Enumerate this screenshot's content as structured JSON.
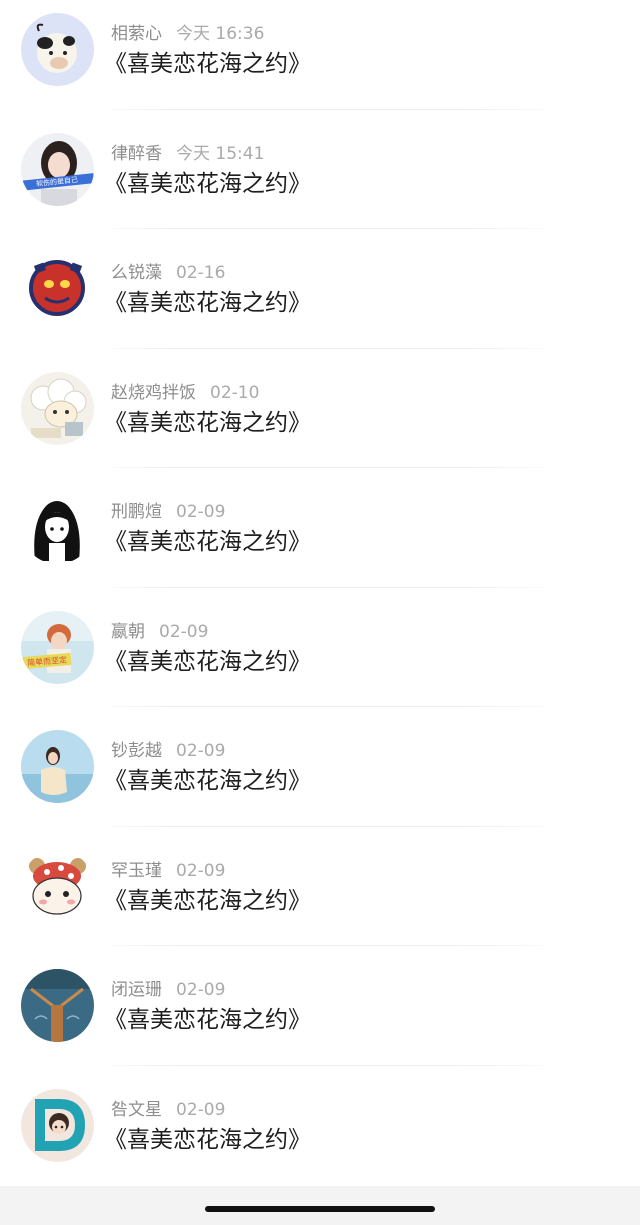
{
  "comments": [
    {
      "name": "相萦心",
      "time": "今天 16:36",
      "message": "《喜美恋花海之约》",
      "avatar_icon": "cartoon-cow-avatar",
      "accent": "#dbe4f7"
    },
    {
      "name": "律醉香",
      "time": "今天 15:41",
      "message": "《喜美恋花海之约》",
      "avatar_icon": "girl-portrait-avatar",
      "accent": "#3a6fd8"
    },
    {
      "name": "么锐藻",
      "time": "02-16",
      "message": "《喜美恋花海之约》",
      "avatar_icon": "red-creature-avatar",
      "accent": "#c8322a"
    },
    {
      "name": "赵烧鸡拌饭",
      "time": "02-10",
      "message": "《喜美恋花海之约》",
      "avatar_icon": "sheep-cartoon-avatar",
      "accent": "#f1ede4"
    },
    {
      "name": "刑鹏煊",
      "time": "02-09",
      "message": "《喜美恋花海之约》",
      "avatar_icon": "anime-girl-avatar",
      "accent": "#111111"
    },
    {
      "name": "嬴朝",
      "time": "02-09",
      "message": "《喜美恋花海之约》",
      "avatar_icon": "redhead-girl-avatar",
      "accent": "#d9a45a"
    },
    {
      "name": "钞彭越",
      "time": "02-09",
      "message": "《喜美恋花海之约》",
      "avatar_icon": "beach-girl-avatar",
      "accent": "#9ccbe6"
    },
    {
      "name": "罕玉瑾",
      "time": "02-09",
      "message": "《喜美恋花海之约》",
      "avatar_icon": "hamster-cartoon-avatar",
      "accent": "#d94a3e"
    },
    {
      "name": "闭运珊",
      "time": "02-09",
      "message": "《喜美恋花海之约》",
      "avatar_icon": "denim-avatar",
      "accent": "#3b6b84"
    },
    {
      "name": "咎文星",
      "time": "02-09",
      "message": "《喜美恋花海之约》",
      "avatar_icon": "letter-d-cartoon-avatar",
      "accent": "#22a3b3"
    }
  ],
  "avatar_texts": {
    "row2": "软伤的是自己",
    "row6": "简单而坚定"
  }
}
